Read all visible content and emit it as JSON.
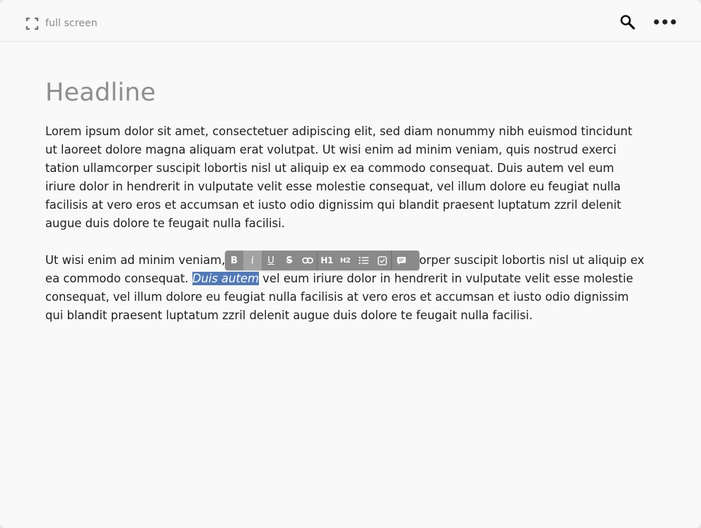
{
  "topbar": {
    "fullscreen_label": "full screen",
    "icons": [
      "fullscreen-icon",
      "search-icon",
      "more-icon"
    ]
  },
  "document": {
    "headline": "Headline",
    "paragraph1": "Lorem ipsum dolor sit amet, consectetuer adipiscing elit, sed diam nonummy nibh euismod tincidunt ut laoreet dolore magna aliquam erat volutpat. Ut wisi enim ad minim veniam, quis nostrud exerci tation ullamcorper suscipit lobortis nisl ut aliquip ex ea commodo consequat. Duis autem vel eum iriure dolor in hendrerit in vulputate velit esse molestie consequat, vel illum dolore eu feugiat nulla facilisis at vero eros et accumsan et iusto odio dignissim qui blandit praesent luptatum zzril delenit augue duis dolore te feugait nulla facilisi.",
    "paragraph2_before": "Ut wisi enim ad minim veniam, quis nostrud exerci tation ullamcorper suscipit lobortis nisl ut aliquip ex ea commodo consequat. ",
    "paragraph2_selected": "Duis autem",
    "paragraph2_after": " vel eum iriure dolor in hendrerit in vulputate velit esse molestie consequat, vel illum dolore eu feugiat nulla facilisis at vero eros et ac­cumsan et iusto odio dignissim qui blandit praesent luptatum zzril delenit augue duis dolore te feugait nulla facilisi."
  },
  "format_toolbar": {
    "bold": "B",
    "italic": "i",
    "underline": "U",
    "strike": "S",
    "h1": "H1",
    "h2": "H2",
    "active": "italic",
    "icons": [
      "link-icon",
      "bullet-list-icon",
      "checkbox-icon",
      "comment-icon"
    ]
  },
  "colors": {
    "selection": "#4f79b8",
    "toolbar": "#8a8a8a",
    "toolbar_active": "#a3a3a3",
    "headline": "#8e8e8e",
    "text": "#1f1f1f"
  }
}
